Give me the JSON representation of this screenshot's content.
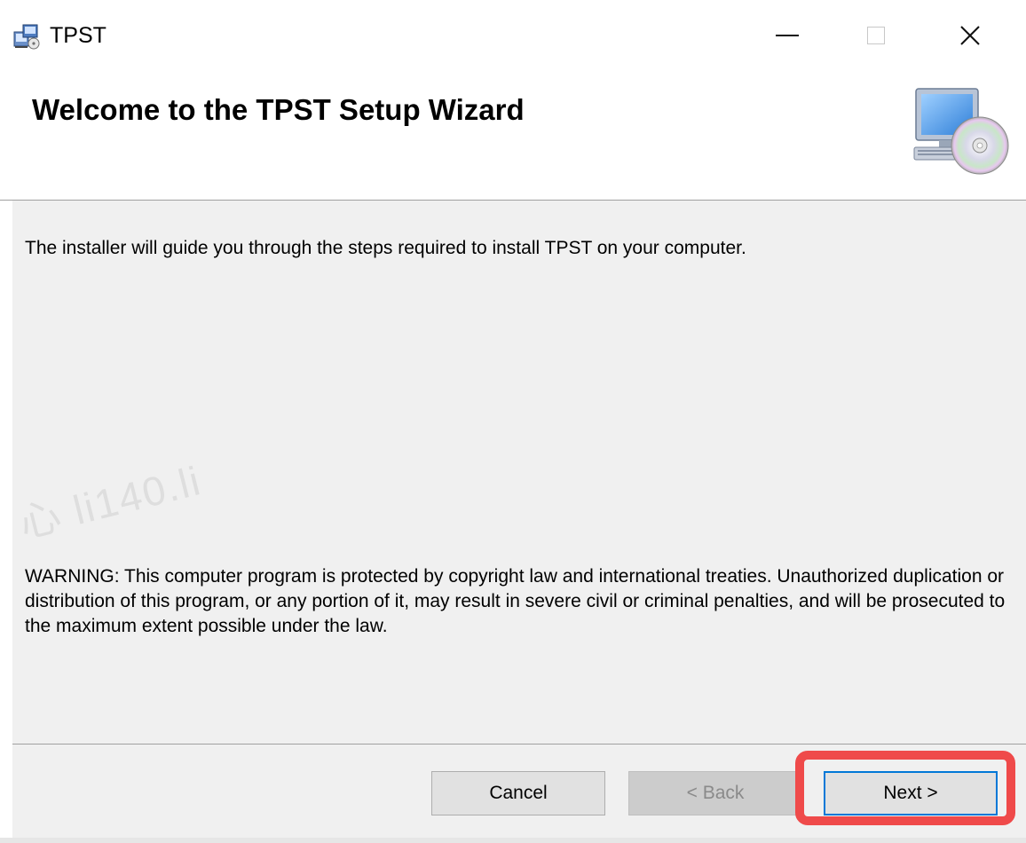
{
  "window": {
    "title": "TPST",
    "minimize_icon": "minimize-icon",
    "maximize_icon": "maximize-icon",
    "close_icon": "close-icon",
    "close_glyph": "✕"
  },
  "banner": {
    "title": "Welcome to the TPST Setup Wizard",
    "graphic_icon": "computer-cd-icon"
  },
  "body": {
    "intro": "The installer will guide you through the steps required to install TPST on your computer.",
    "warning": "WARNING: This computer program is protected by copyright law and international treaties. Unauthorized duplication or distribution of this program, or any portion of it, may result in severe civil or criminal penalties, and will be prosecuted to the maximum extent possible under the law.",
    "watermark": "心 li140.li"
  },
  "footer": {
    "cancel_label": "Cancel",
    "back_label": "< Back",
    "next_label": "Next >",
    "back_enabled": false,
    "highlight_color": "#ef4a4a",
    "focus_color": "#0078d7"
  }
}
